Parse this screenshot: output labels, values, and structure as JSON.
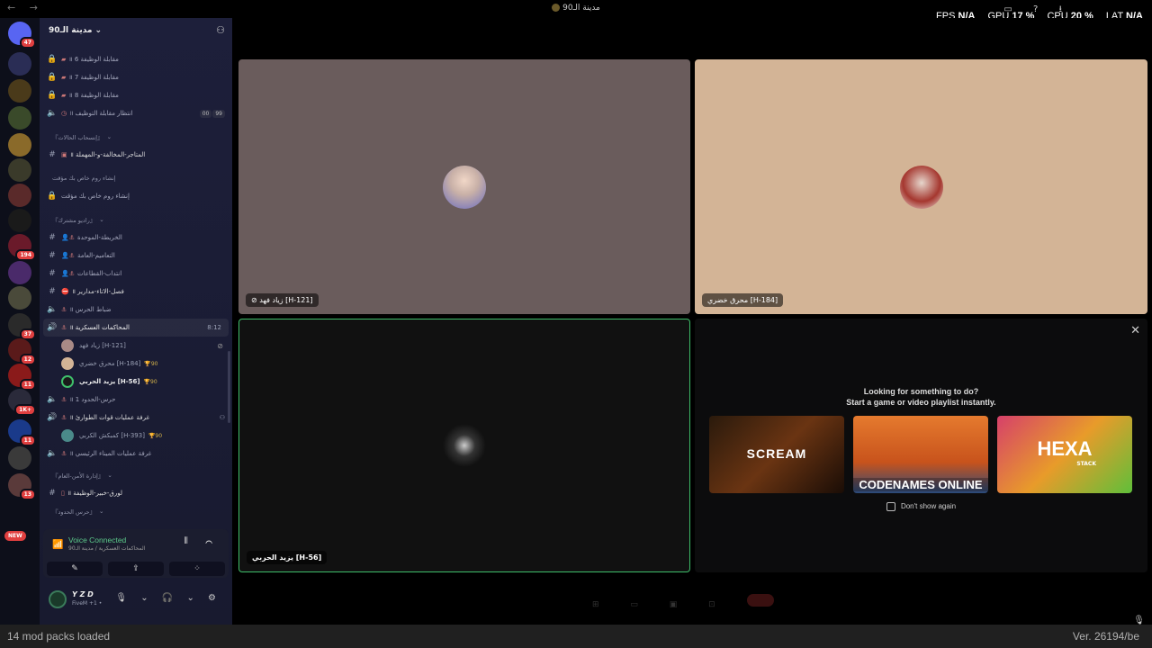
{
  "titlebar": {
    "nav": "← →",
    "title": "مدينة الـ90",
    "icons": "▭ ? ⭳"
  },
  "perf": {
    "fps_label": "FPS",
    "fps_value": "N/A",
    "gpu_label": "GPU",
    "gpu_value": "17 %",
    "cpu_label": "CPU",
    "cpu_value": "20 %",
    "lat_label": "LAT",
    "lat_value": "N/A"
  },
  "rail": {
    "badges": [
      "47",
      "",
      "",
      "",
      "",
      "",
      "",
      "194",
      "",
      "",
      "37",
      "12",
      "11",
      "1K+",
      "11",
      "",
      "13"
    ],
    "new_badge": "NEW"
  },
  "guild": {
    "name": "مدينة الـ90",
    "invite_icon": "add-user-icon"
  },
  "channels": {
    "job1": "مقابلة الوظيفة 6 ॥",
    "job2": "مقابلة الوظيفة 7 ॥",
    "job3": "مقابلة الوظيفة 8 ॥",
    "wait": "انتظار مقابلة التوظيف ॥",
    "wait_cnt_a": "00",
    "wait_cnt_b": "99",
    "cat_withdraw": "『إنسحاب الحالات』",
    "shop": "المتاجر-المخالفة-و-المهملة ॥",
    "cat_create": "إنشاء روم خاص بك مؤقت",
    "create": "إنشاء روم خاص بك مؤقت",
    "cat_radio": "『راديو مشترك』",
    "r1": "الخريطة-الموحدة",
    "r2": "التعاميم-العامة",
    "r3": "انتداب-القطاعات",
    "r4": "فصل-الاتاء-مدارير ॥",
    "r5": "ضباط الحرس ॥",
    "mil": "المحاكمات العسكرية ॥",
    "mil_time": "8:12",
    "u1": "زياد فهد [H-121]",
    "u2": "محرق خضري [H-184]",
    "u2_trophy": "🏆90",
    "u3": "يزيد الحربي [H-56]",
    "u3_trophy": "🏆90",
    "border": "حرس-الحدود 1 ॥",
    "ops": "غرفة عمليات قوات الطوارئ ॥",
    "u4": "كمبكش الكربي [H-393]",
    "u4_trophy": "🏆90",
    "port": "غرفة عمليات الميناء الرئيسي ॥",
    "cat_security": "『إدارة الأمن-العام』",
    "lorq": "لورق-خبير-الوظيفة ॥",
    "cat_border": "『حرس الحدود』"
  },
  "voice_panel": {
    "title": "Voice Connected",
    "subtitle": "المحاكمات العسكرية / مدينة الـ90",
    "controls": "⦀ ⌒",
    "btn1": "✎",
    "btn2": "⇪",
    "btn3": "⁘"
  },
  "user_panel": {
    "name": "Y Z D",
    "sub": "FiveM +1 •",
    "controls": "🎙 ⌄ 🎧 ⌄ ⚙"
  },
  "tiles": {
    "t1_name": "زياد فهد [H-121]",
    "t2_name": "محرق خضري [H-184]",
    "t3_name": "يزيد الحربي [H-56]"
  },
  "activity": {
    "close": "✕",
    "line1": "Looking for something to do?",
    "line2": "Start a game or video playlist instantly.",
    "games": [
      "SCREAM",
      "CODENAMES ONLINE",
      "HEXA"
    ],
    "hexa_sub": "STACK",
    "dont_show": "Don't show again"
  },
  "status": {
    "left": "14 mod packs loaded",
    "right": "Ver. 26194/be",
    "mic": "🎙"
  },
  "colors": {
    "connected": "#5cc98a",
    "speaking_border": "#3fbf6a",
    "badge": "#e03f3f"
  }
}
